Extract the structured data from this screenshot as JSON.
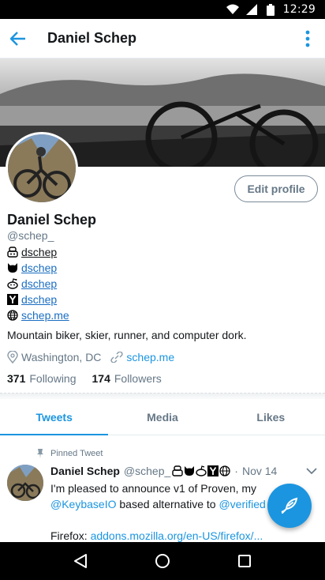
{
  "status_bar": {
    "time": "12:29"
  },
  "app_bar": {
    "title": "Daniel Schep"
  },
  "profile": {
    "edit_label": "Edit profile",
    "name": "Daniel Schep",
    "handle": "@schep_",
    "links": [
      {
        "icon": "keybase-icon",
        "text": "dschep",
        "style": "plain"
      },
      {
        "icon": "github-icon",
        "text": "dschep",
        "style": "blue"
      },
      {
        "icon": "reddit-icon",
        "text": "dschep",
        "style": "blue"
      },
      {
        "icon": "hackernews-icon",
        "text": "dschep",
        "style": "blue"
      },
      {
        "icon": "globe-icon",
        "text": "schep.me",
        "style": "blue"
      }
    ],
    "bio": "Mountain biker, skier, runner, and computer dork.",
    "location": "Washington, DC",
    "website": "schep.me",
    "following_count": "371",
    "following_label": "Following",
    "followers_count": "174",
    "followers_label": "Followers"
  },
  "tabs": [
    {
      "label": "Tweets",
      "active": true
    },
    {
      "label": "Media",
      "active": false
    },
    {
      "label": "Likes",
      "active": false
    }
  ],
  "tweet": {
    "pinned_label": "Pinned Tweet",
    "author_name": "Daniel Schep",
    "author_handle": "@schep_",
    "dot": "·",
    "date": "Nov 14",
    "line1": "I'm pleased to announce v1 of Proven, my",
    "line2_link1": "@KeybaseIO",
    "line2_mid": " based alternative to ",
    "line2_link2": "@verified",
    "line4_prefix": "Firefox: ",
    "line4_link": "addons.mozilla.org/en-US/firefox/..."
  },
  "colors": {
    "accent": "#1b95e0",
    "muted": "#657786",
    "text": "#14171a"
  }
}
